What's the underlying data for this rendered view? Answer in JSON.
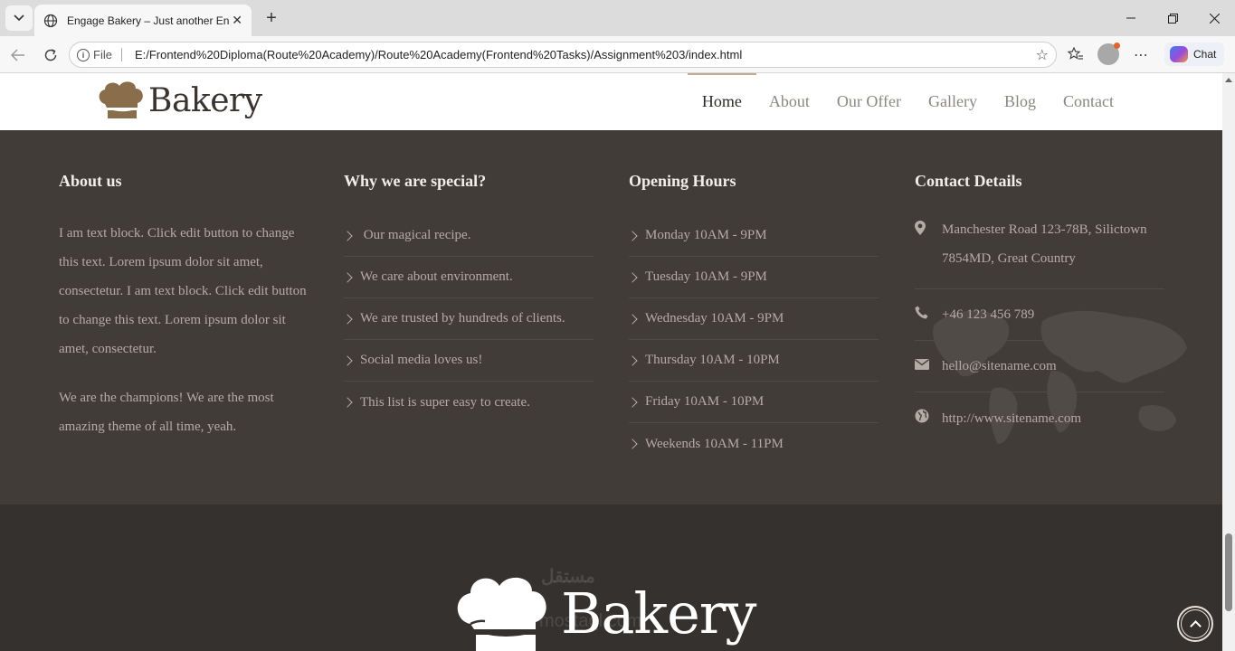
{
  "browser": {
    "tab_title": "Engage Bakery – Just another Engage",
    "omnibox_scheme": "File",
    "url": "E:/Frontend%20Diploma(Route%20Academy)/Route%20Academy(Frontend%20Tasks)/Assignment%203/index.html",
    "chat_label": "Chat"
  },
  "header": {
    "brand": "Bakery",
    "nav": [
      "Home",
      "About",
      "Our Offer",
      "Gallery",
      "Blog",
      "Contact"
    ],
    "active_nav": "Home"
  },
  "footer": {
    "about": {
      "heading": "About us",
      "paragraph_1": "I am text block. Click edit button to change this text. Lorem ipsum dolor sit amet, consectetur. I am text block. Click edit button to change this text. Lorem ipsum dolor sit amet, consectetur.",
      "paragraph_2": "We are the champions! We are the most amazing theme of all time, yeah."
    },
    "special": {
      "heading": "Why we are special?",
      "items": [
        " Our magical recipe.",
        "We care about environment.",
        "We are trusted by hundreds of clients.",
        "Social media loves us!",
        "This list is super easy to create."
      ]
    },
    "hours": {
      "heading": "Opening Hours",
      "items": [
        "Monday 10AM - 9PM",
        "Tuesday 10AM - 9PM",
        "Wednesday 10AM - 9PM",
        "Thursday 10AM - 10PM",
        "Friday 10AM - 10PM",
        "Weekends 10AM - 11PM"
      ]
    },
    "contact": {
      "heading": "Contact Details",
      "address": "Manchester Road 123-78B, Silictown 7854MD, Great Country",
      "phone": "+46 123 456 789",
      "email": "hello@sitename.com",
      "website": "http://www.sitename.com"
    },
    "bottom_brand": "Bakery",
    "watermark_arabic": "مستقل",
    "watermark_latin": "mostaql.com"
  },
  "colors": {
    "accent": "#c1aa90",
    "logo_brown": "#8a6d4b",
    "footer_bg": "#413c37",
    "footer_bottom_bg": "#35312e"
  }
}
